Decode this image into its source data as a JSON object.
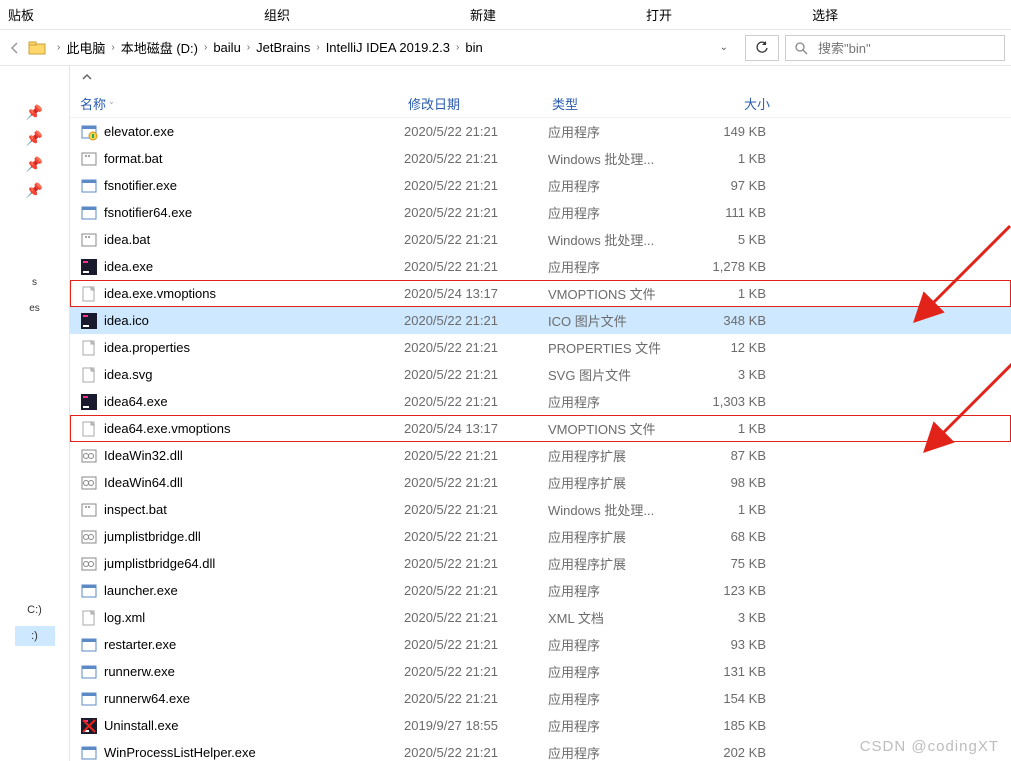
{
  "menu": {
    "clipboard": "贴板",
    "organize": "组织",
    "new_": "新建",
    "open_": "打开",
    "select": "选择"
  },
  "breadcrumbs": {
    "this_pc": "此电脑",
    "drive": "本地磁盘 (D:)",
    "p1": "bailu",
    "p2": "JetBrains",
    "p3": "IntelliJ IDEA 2019.2.3",
    "p4": "bin"
  },
  "search": {
    "placeholder": "搜索\"bin\""
  },
  "columns": {
    "name": "名称",
    "date": "修改日期",
    "type": "类型",
    "size": "大小"
  },
  "files": [
    {
      "icon": "exe-uac",
      "name": "elevator.exe",
      "date": "2020/5/22 21:21",
      "type": "应用程序",
      "size": "149 KB"
    },
    {
      "icon": "bat",
      "name": "format.bat",
      "date": "2020/5/22 21:21",
      "type": "Windows 批处理...",
      "size": "1 KB"
    },
    {
      "icon": "exe",
      "name": "fsnotifier.exe",
      "date": "2020/5/22 21:21",
      "type": "应用程序",
      "size": "97 KB"
    },
    {
      "icon": "exe",
      "name": "fsnotifier64.exe",
      "date": "2020/5/22 21:21",
      "type": "应用程序",
      "size": "111 KB"
    },
    {
      "icon": "bat",
      "name": "idea.bat",
      "date": "2020/5/22 21:21",
      "type": "Windows 批处理...",
      "size": "5 KB"
    },
    {
      "icon": "idea",
      "name": "idea.exe",
      "date": "2020/5/22 21:21",
      "type": "应用程序",
      "size": "1,278 KB"
    },
    {
      "icon": "file",
      "name": "idea.exe.vmoptions",
      "date": "2020/5/24 13:17",
      "type": "VMOPTIONS 文件",
      "size": "1 KB",
      "highlighted": true
    },
    {
      "icon": "idea",
      "name": "idea.ico",
      "date": "2020/5/22 21:21",
      "type": "ICO 图片文件",
      "size": "348 KB",
      "selected": true
    },
    {
      "icon": "file",
      "name": "idea.properties",
      "date": "2020/5/22 21:21",
      "type": "PROPERTIES 文件",
      "size": "12 KB"
    },
    {
      "icon": "file",
      "name": "idea.svg",
      "date": "2020/5/22 21:21",
      "type": "SVG 图片文件",
      "size": "3 KB"
    },
    {
      "icon": "idea",
      "name": "idea64.exe",
      "date": "2020/5/22 21:21",
      "type": "应用程序",
      "size": "1,303 KB"
    },
    {
      "icon": "file",
      "name": "idea64.exe.vmoptions",
      "date": "2020/5/24 13:17",
      "type": "VMOPTIONS 文件",
      "size": "1 KB",
      "highlighted": true
    },
    {
      "icon": "dll",
      "name": "IdeaWin32.dll",
      "date": "2020/5/22 21:21",
      "type": "应用程序扩展",
      "size": "87 KB"
    },
    {
      "icon": "dll",
      "name": "IdeaWin64.dll",
      "date": "2020/5/22 21:21",
      "type": "应用程序扩展",
      "size": "98 KB"
    },
    {
      "icon": "bat",
      "name": "inspect.bat",
      "date": "2020/5/22 21:21",
      "type": "Windows 批处理...",
      "size": "1 KB"
    },
    {
      "icon": "dll",
      "name": "jumplistbridge.dll",
      "date": "2020/5/22 21:21",
      "type": "应用程序扩展",
      "size": "68 KB"
    },
    {
      "icon": "dll",
      "name": "jumplistbridge64.dll",
      "date": "2020/5/22 21:21",
      "type": "应用程序扩展",
      "size": "75 KB"
    },
    {
      "icon": "exe",
      "name": "launcher.exe",
      "date": "2020/5/22 21:21",
      "type": "应用程序",
      "size": "123 KB"
    },
    {
      "icon": "file",
      "name": "log.xml",
      "date": "2020/5/22 21:21",
      "type": "XML 文档",
      "size": "3 KB"
    },
    {
      "icon": "exe",
      "name": "restarter.exe",
      "date": "2020/5/22 21:21",
      "type": "应用程序",
      "size": "93 KB"
    },
    {
      "icon": "exe",
      "name": "runnerw.exe",
      "date": "2020/5/22 21:21",
      "type": "应用程序",
      "size": "131 KB"
    },
    {
      "icon": "exe",
      "name": "runnerw64.exe",
      "date": "2020/5/22 21:21",
      "type": "应用程序",
      "size": "154 KB"
    },
    {
      "icon": "idea-x",
      "name": "Uninstall.exe",
      "date": "2019/9/27 18:55",
      "type": "应用程序",
      "size": "185 KB"
    },
    {
      "icon": "exe",
      "name": "WinProcessListHelper.exe",
      "date": "2020/5/22 21:21",
      "type": "应用程序",
      "size": "202 KB"
    }
  ],
  "sidebar_labels": {
    "c_drive": "C:)",
    "d_drive": ":)"
  },
  "watermark": "CSDN @codingXT"
}
